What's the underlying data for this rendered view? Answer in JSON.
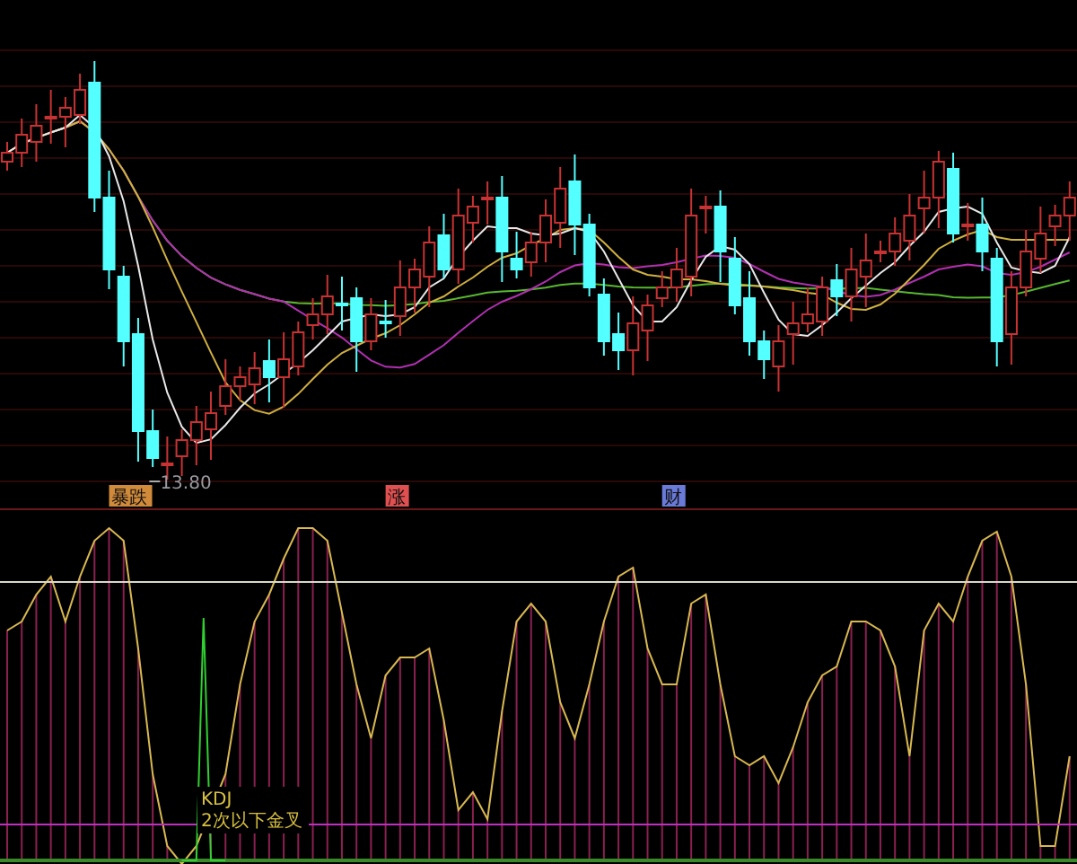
{
  "price_chart": {
    "low_marker": "13.80",
    "signals": [
      {
        "label": "暴跌",
        "color": "#d08a3a"
      },
      {
        "label": "涨",
        "color": "#e05050"
      },
      {
        "label": "财",
        "color": "#6a7ad8"
      }
    ]
  },
  "indicator_chart": {
    "name": "KDJ",
    "signal_text": "2次以下金叉"
  }
}
